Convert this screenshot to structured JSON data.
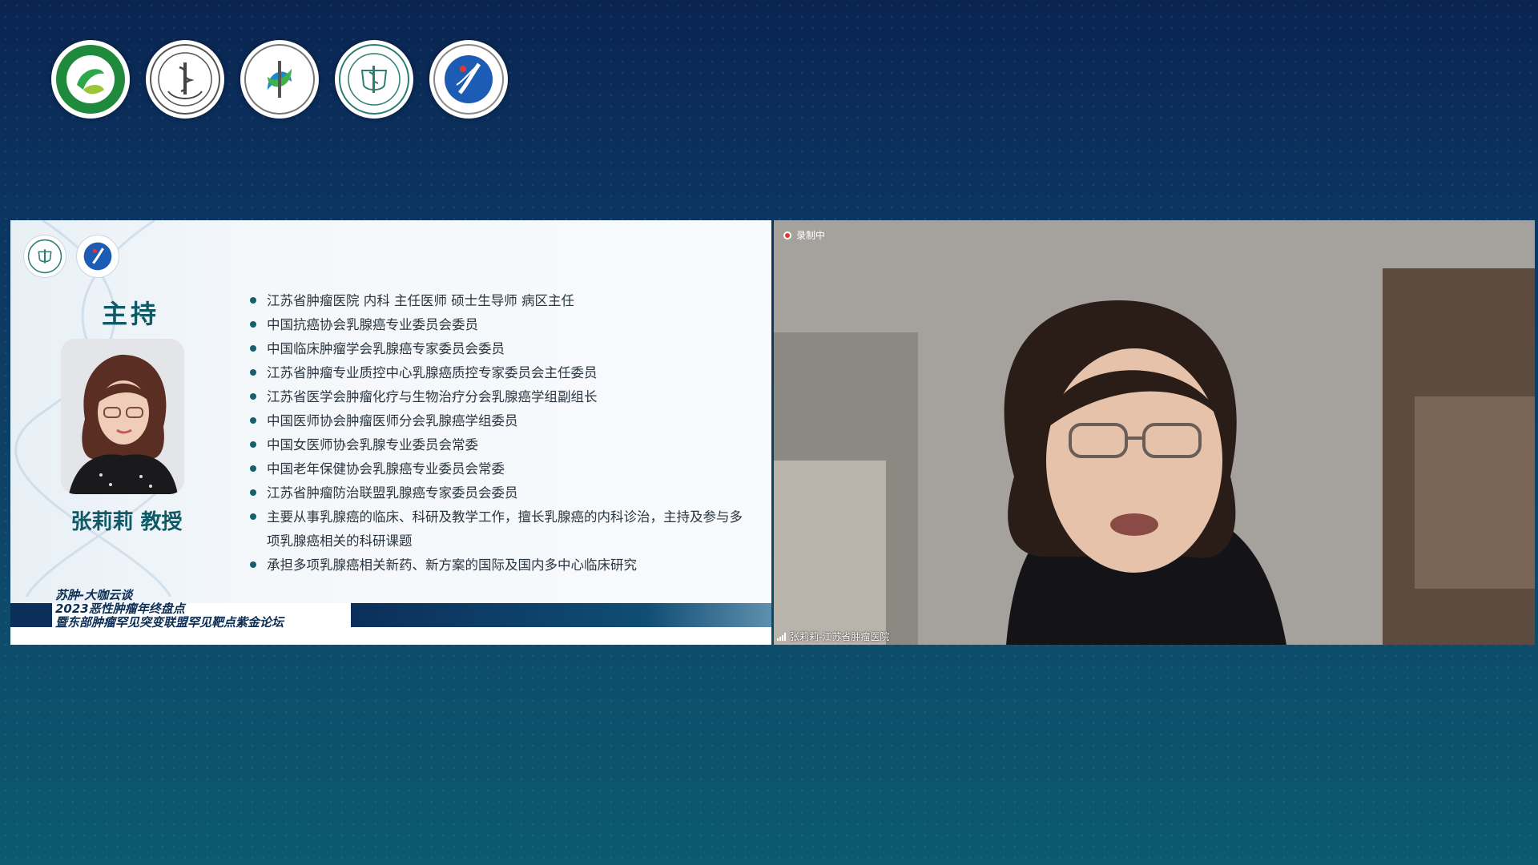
{
  "slide": {
    "host_title": "主持",
    "host_name": "张莉莉 教授",
    "bio": [
      "江苏省肿瘤医院  内科 主任医师  硕士生导师  病区主任",
      "中国抗癌协会乳腺癌专业委员会委员",
      "中国临床肿瘤学会乳腺癌专家委员会委员",
      "江苏省肿瘤专业质控中心乳腺癌质控专家委员会主任委员",
      "江苏省医学会肿瘤化疗与生物治疗分会乳腺癌学组副组长",
      "中国医师协会肿瘤医师分会乳腺癌学组委员",
      "中国女医师协会乳腺专业委员会常委",
      "中国老年保健协会乳腺癌专业委员会常委",
      "江苏省肿瘤防治联盟乳腺癌专家委员会委员",
      "主要从事乳腺癌的临床、科研及教学工作，擅长乳腺癌的内科诊治，主持及参与多项乳腺癌相关的科研课题",
      "承担多项乳腺癌相关新药、新方案的国际及国内多中心临床研究"
    ],
    "forum_lines": [
      "苏肿-大咖云谈",
      "2023恶性肿瘤年终盘点",
      "暨东部肿瘤罕见突变联盟罕见靶点紫金论坛"
    ]
  },
  "video": {
    "recording_label": "录制中",
    "participant_label": "张莉莉-江苏省肿瘤医院"
  },
  "colors": {
    "accent_teal": "#0f5a66",
    "navy": "#0b2f5a",
    "recording_red": "#e0392f"
  },
  "logos": [
    "jiangsu-society-immunology-logo",
    "jsmda-logo",
    "jiangsu-research-hospital-association-logo",
    "jiangsu-cancer-hospital-logo",
    "eastern-cancer-rare-mutation-alliance-logo"
  ]
}
